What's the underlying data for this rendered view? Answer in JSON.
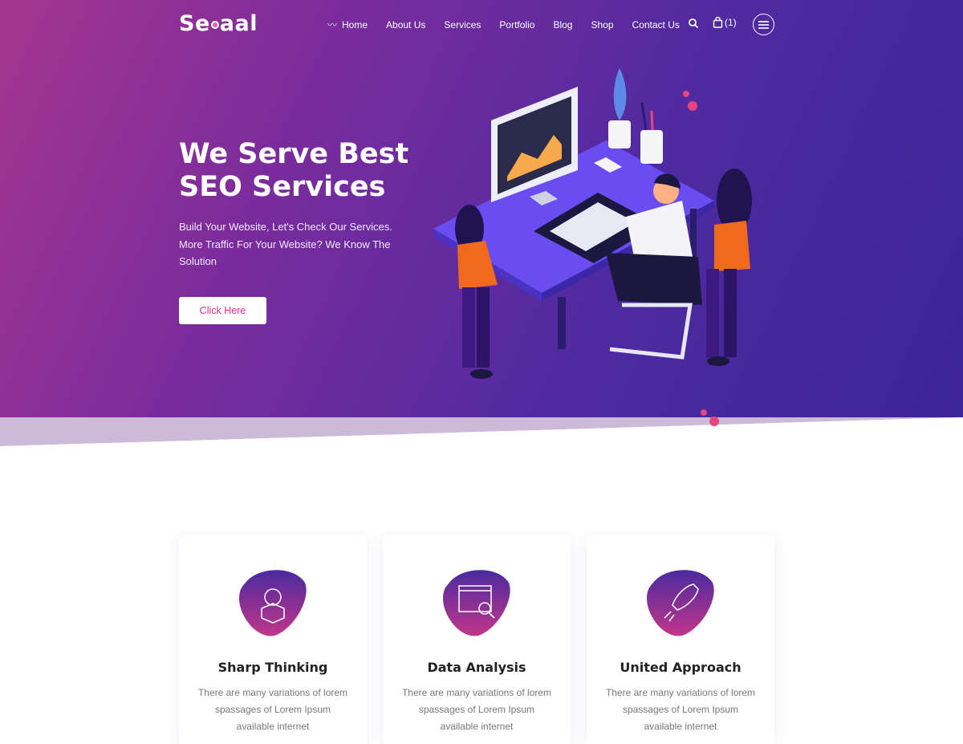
{
  "brand": {
    "name_part1": "Se",
    "name_part2": "aal"
  },
  "nav": {
    "items": [
      "Home",
      "About Us",
      "Services",
      "Portfolio",
      "Blog",
      "Shop",
      "Contact Us"
    ],
    "cart_count": "(1)"
  },
  "hero": {
    "title_line1": "We Serve Best",
    "title_line2": "SEO Services",
    "subtitle": "Build Your Website, Let's Check Our Services. More Traffic For Your Website? We Know The Solution",
    "button": "Click Here"
  },
  "features": [
    {
      "title": "Sharp Thinking",
      "text": "There are many variations of lorem spassages of Lorem Ipsum available internet",
      "icon": "brain-box-icon"
    },
    {
      "title": "Data Analysis",
      "text": "There are many variations of lorem spassages of Lorem Ipsum available internet",
      "icon": "chart-magnifier-icon"
    },
    {
      "title": "United Approach",
      "text": "There are many variations of lorem spassages of Lorem Ipsum available internet",
      "icon": "rocket-icon"
    }
  ],
  "colors": {
    "accent": "#d9338e",
    "hero_start": "#a5368f",
    "hero_end": "#3a2497"
  }
}
